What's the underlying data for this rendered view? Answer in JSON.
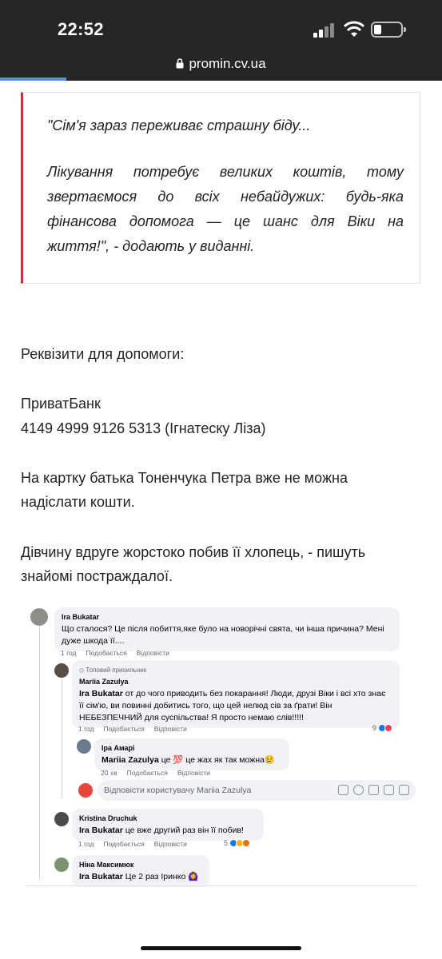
{
  "status_bar": {
    "time": "22:52",
    "url": "promin.cv.ua"
  },
  "quote": {
    "line1": "\"Сім'я зараз переживає страшну біду...",
    "line2": "Лікування потребує великих коштів, тому звертаємося до всіх небайдужих: будь-яка фінансова допомога — це шанс для Віки на життя!\", - додають у виданні."
  },
  "article": {
    "requisites_title": "Реквізити для допомоги:",
    "bank_name": "ПриватБанк",
    "card_line": "4149 4999 9126 5313 (Ігнатеску Ліза)",
    "father_card_note": "На картку батька Тоненчука Петра вже не можна надіслати кошти.",
    "beaten_note": "Дівчину вдруге жорстоко побив її хлопець, - пишуть знайомі постраждалої."
  },
  "fb_comments": {
    "actions": {
      "like": "Подобається",
      "reply": "Відповісти"
    },
    "c1": {
      "author": "Ira Bukatar",
      "text": "Що сталося? Це після побиття,яке було на новорічні свята, чи інша причина? Мені дуже шкода її....",
      "time": "1 год"
    },
    "c2": {
      "badge": "Топовий прихильник",
      "author": "Mariia Zazulya",
      "mention": "Ira Bukatar",
      "text": " от до чого приводить без покарання! Люди, друзі Віки і всі хто знає її сім'ю, ви повинні добитись того, що цей нелюд сів за ґрати! Він НЕБЕЗПЕЧНИЙ для суспільства! Я просто немаю слів!!!!!",
      "time": "1 год",
      "reactions": "9"
    },
    "c3": {
      "author": "Іра Амарі",
      "mention": "Mariia Zazulya",
      "text": " це 💯 це жах як так можна😢",
      "time": "20 хв"
    },
    "reply_placeholder": "Відповісти користувачу Mariia Zazulya",
    "c4": {
      "author": "Kristina Druchuk",
      "mention": "Ira Bukatar",
      "text": " це вже другий раз він її побив!",
      "time": "1 год",
      "reactions": "5"
    },
    "c5": {
      "author": "Ніна Максимюк",
      "mention": "Ira Bukatar",
      "text": " Це 2 раз Іринко 🙆‍♀️"
    }
  },
  "colors": {
    "quote_border": "#c7323e",
    "topbar": "#262626",
    "url_progress": "#5b8ee8"
  }
}
